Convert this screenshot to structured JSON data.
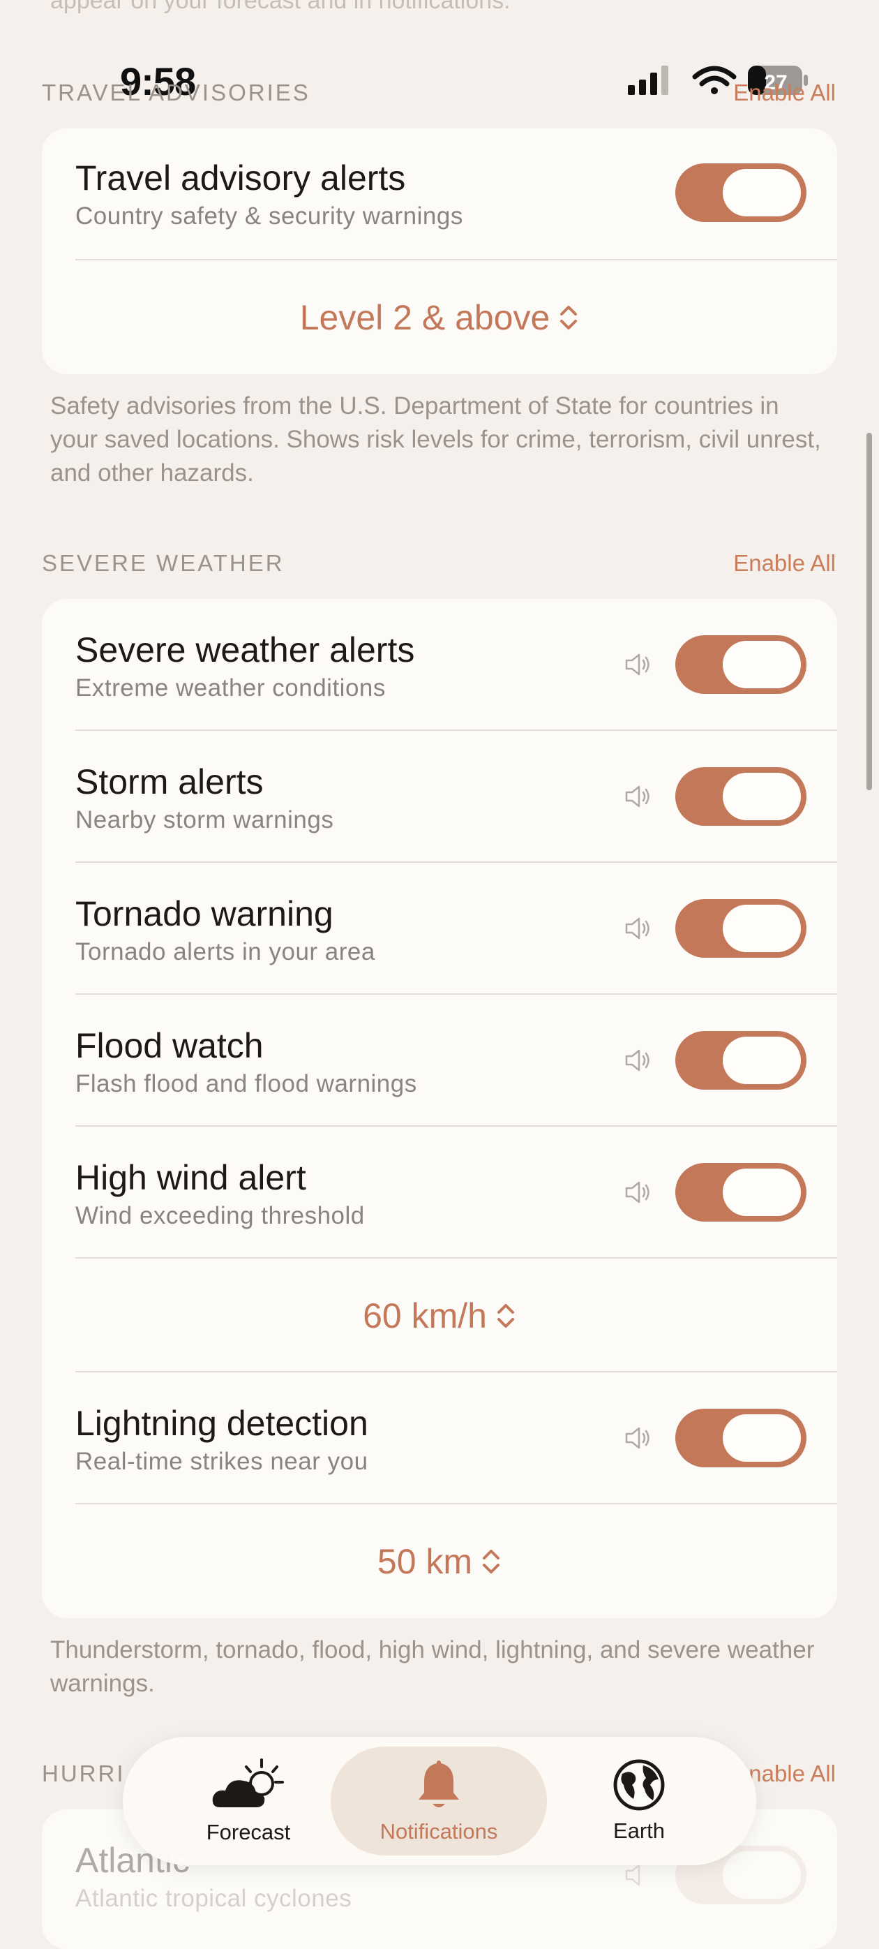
{
  "top_fade_text": "appear on your forecast and in notifications.",
  "status": {
    "time": "9:58",
    "battery": "27"
  },
  "travel": {
    "header": "TRAVEL ADVISORIES",
    "enable_all": "Enable All",
    "alert_title": "Travel advisory alerts",
    "alert_sub": "Country safety & security warnings",
    "picker": "Level 2 & above",
    "footnote": "Safety advisories from the U.S. Department of State for countries in your saved locations. Shows risk levels for crime, terrorism, civil unrest, and other hazards."
  },
  "severe": {
    "header": "SEVERE WEATHER",
    "enable_all": "Enable All",
    "rows": [
      {
        "title": "Severe weather alerts",
        "sub": "Extreme weather conditions"
      },
      {
        "title": "Storm alerts",
        "sub": "Nearby storm warnings"
      },
      {
        "title": "Tornado warning",
        "sub": "Tornado alerts in your area"
      },
      {
        "title": "Flood watch",
        "sub": "Flash flood and flood warnings"
      },
      {
        "title": "High wind alert",
        "sub": "Wind exceeding threshold"
      }
    ],
    "wind_picker": "60 km/h",
    "lightning": {
      "title": "Lightning detection",
      "sub": "Real-time strikes near you"
    },
    "lightning_picker": "50 km",
    "footnote": "Thunderstorm, tornado, flood, high wind, lightning, and severe weather warnings."
  },
  "hurricane": {
    "header": "HURRI",
    "enable_all": "nable All",
    "row_title": "Atlantic",
    "row_sub": "Atlantic tropical cyclones"
  },
  "tabs": {
    "forecast": "Forecast",
    "notifications": "Notifications",
    "earth": "Earth"
  },
  "colors": {
    "accent": "#c3785a",
    "background": "#f5f0eb",
    "card": "#fdfbf7"
  }
}
